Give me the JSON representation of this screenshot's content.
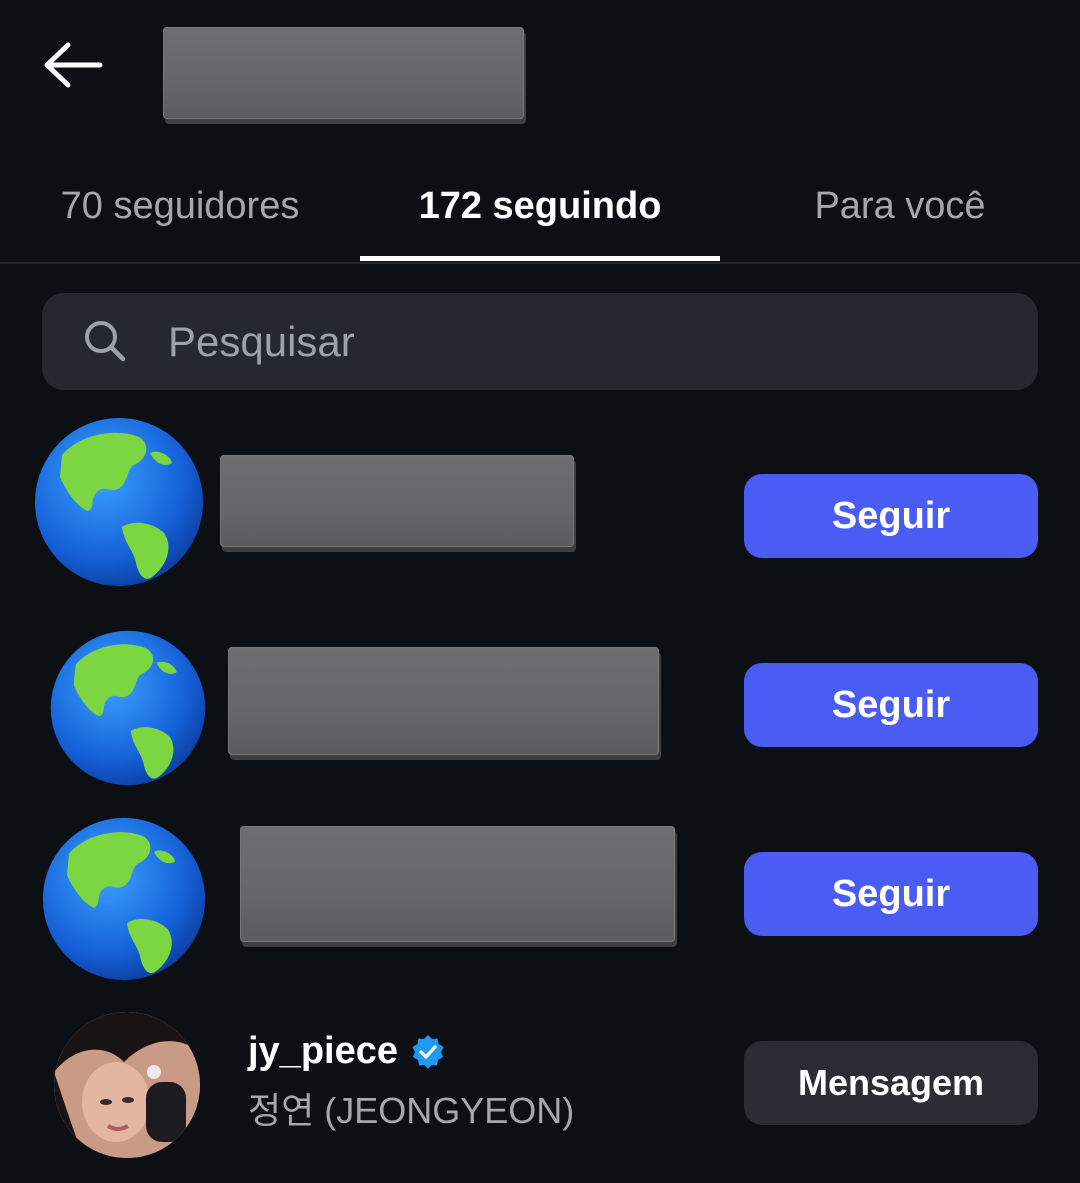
{
  "header": {
    "back_icon": "arrow-left-icon",
    "title_redacted": true
  },
  "tabs": [
    {
      "label": "70 seguidores",
      "active": false
    },
    {
      "label": "172 seguindo",
      "active": true
    },
    {
      "label": "Para você",
      "active": false
    }
  ],
  "search": {
    "placeholder": "Pesquisar",
    "value": "",
    "icon": "search-icon"
  },
  "list": {
    "items": [
      {
        "avatar": "globe-emoji",
        "name_redacted": true,
        "action_label": "Seguir"
      },
      {
        "avatar": "globe-emoji",
        "name_redacted": true,
        "action_label": "Seguir"
      },
      {
        "avatar": "globe-emoji",
        "name_redacted": true,
        "action_label": "Seguir"
      },
      {
        "avatar": "profile-photo",
        "username": "jy_piece",
        "verified": true,
        "full_name": "정연 (JEONGYEON)",
        "action_label": "Mensagem"
      }
    ]
  },
  "colors": {
    "background": "#0c0f14",
    "follow_button": "#4b5cf5",
    "message_button": "#2a2d33",
    "search_bg": "#25282e",
    "verified_badge": "#1d9bf0"
  }
}
